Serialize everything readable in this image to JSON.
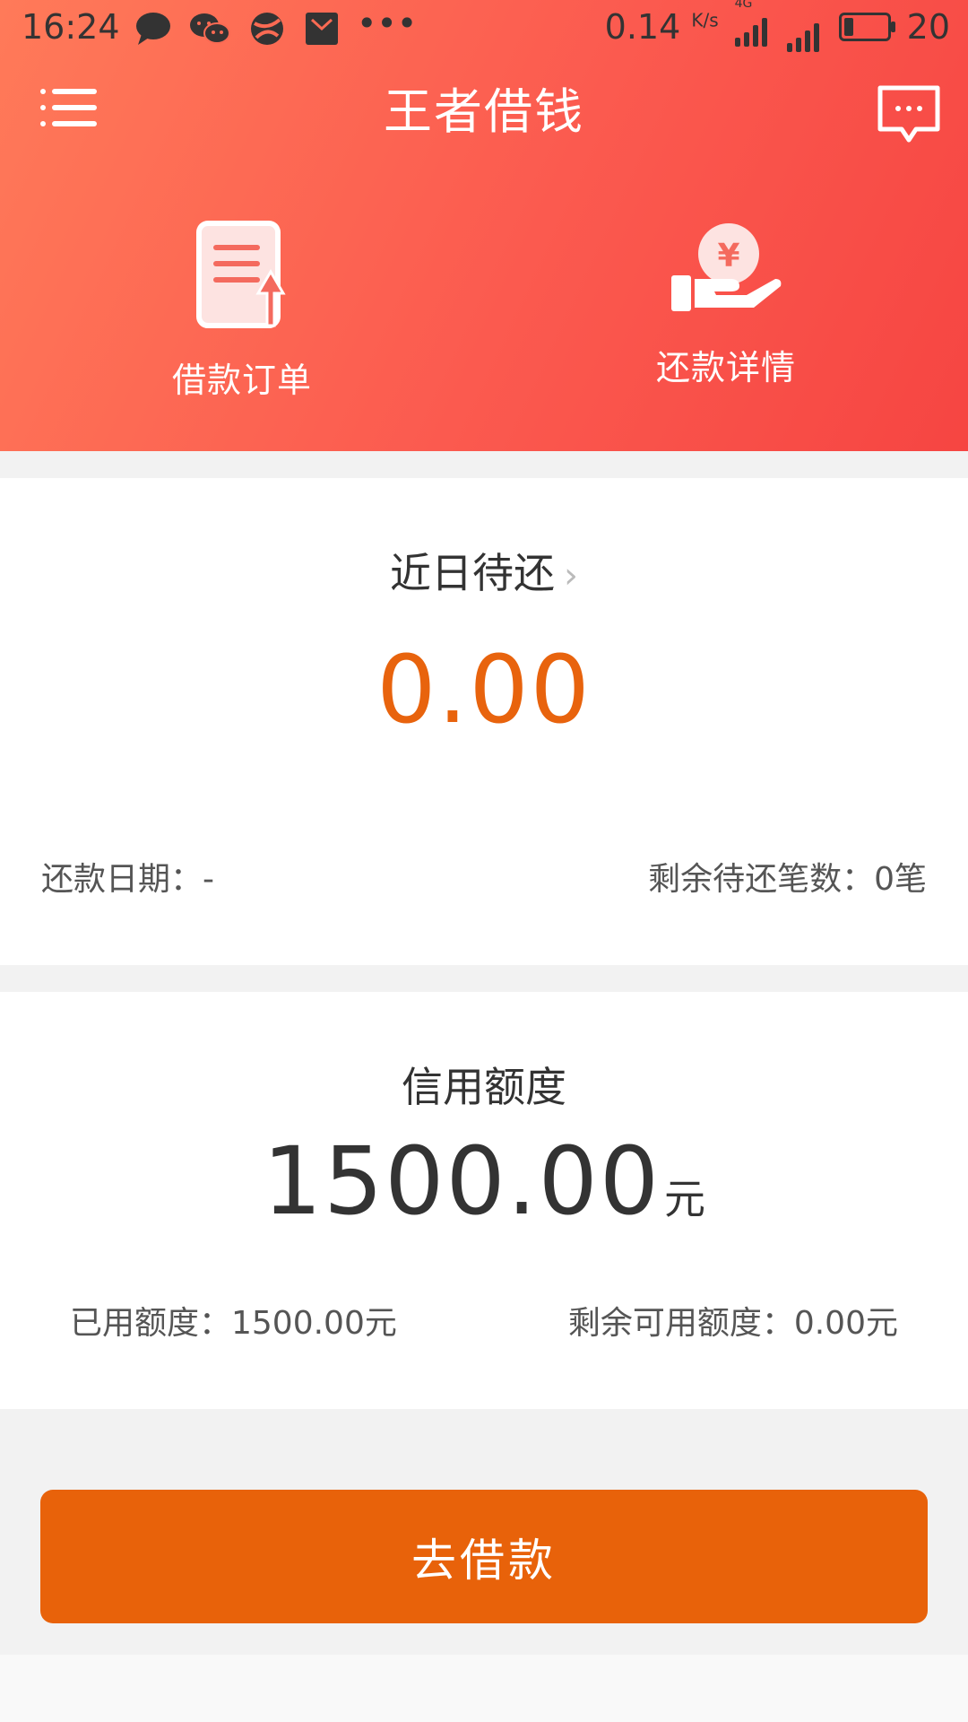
{
  "status_bar": {
    "time": "16:24",
    "network_speed": "0.14",
    "network_unit": "K/s",
    "network_type": "4G",
    "battery": "20",
    "icons": [
      "chat-bubble-icon",
      "wechat-icon",
      "browser-icon",
      "mail-icon",
      "more-dots-icon"
    ]
  },
  "header": {
    "title": "王者借钱",
    "left_icon": "menu-icon",
    "right_icon": "message-icon",
    "gradient_start": "#ff7a59",
    "gradient_end": "#f64542",
    "quick_actions": [
      {
        "label": "借款订单",
        "icon": "document-upload-icon"
      },
      {
        "label": "还款详情",
        "icon": "hand-yen-icon"
      }
    ]
  },
  "due_card": {
    "title": "近日待还",
    "chevron": "›",
    "amount": "0.00",
    "amount_color": "#e8630d",
    "repay_date_label": "还款日期：-",
    "remaining_count_label": "剩余待还笔数：0笔"
  },
  "credit_card": {
    "title": "信用额度",
    "amount": "1500.00",
    "unit": "元",
    "used_label": "已用额度：1500.00元",
    "remaining_label": "剩余可用额度：0.00元"
  },
  "action": {
    "borrow_button": "去借款",
    "button_color": "#e8620a"
  }
}
